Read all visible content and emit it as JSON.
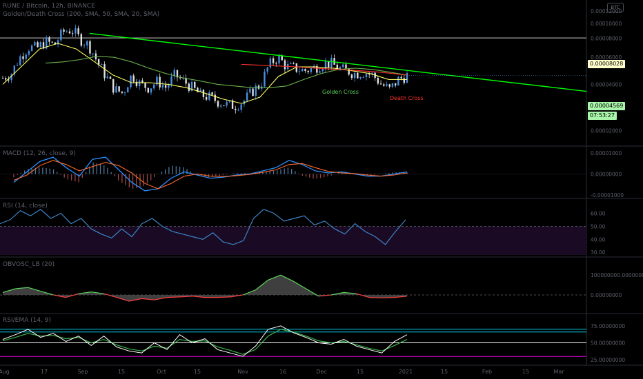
{
  "header": {
    "symbol_line": "RUNE / Bitcoin, 12h, BINANCE",
    "indicator_line": "Golden/Death Cross (200, SMA, 50, SMA, 20, SMA)",
    "currency_badge": "BTC"
  },
  "price_tags": {
    "trendline_level": "0.00008028",
    "last_price": "0.00004569",
    "bar_timer": "07:53:27"
  },
  "annotations": {
    "golden_cross": "Golden Cross",
    "death_cross": "Death Cross"
  },
  "pane_titles": {
    "macd": "MACD (12, 26, close, 9)",
    "rsi": "RSI (14, close)",
    "obv": "OBVOSC_LB (20)",
    "rsi_ema": "RSI/EMA (14, 9)"
  },
  "time_axis": {
    "labels": [
      "Aug",
      "17",
      "Sep",
      "15",
      "Oct",
      "15",
      "Nov",
      "16",
      "Dec",
      "15",
      "2021",
      "15",
      "Feb",
      "15",
      "Mar"
    ]
  },
  "colors": {
    "background": "#000000",
    "up_candle": "#4a8fe0",
    "down_candle": "#e0e0e0",
    "ma_short": "#ffff66",
    "ma_mid": "#6ab04c",
    "ma_long": "#ff3030",
    "trendline": "#00ff00",
    "macd": "#2b8fff",
    "signal": "#ff6b2b",
    "rsi": "#3d85c6",
    "rsi_band": "#1a0a24",
    "obv_pos": "#5cd65c",
    "obv_neg": "#ff4040",
    "rsi_ema_fast": "#ffffff",
    "rsi_ema_slow": "#39b54a",
    "level_cyan": "#00e5ff",
    "level_magenta": "#ff00ff"
  },
  "chart_data": [
    {
      "type": "candlestick",
      "title": "RUNE / Bitcoin, 12h, BINANCE",
      "x_axis": "time",
      "y_scale": "log",
      "y_ticks": [
        "0.00012000",
        "0.00010000",
        "0.00008000",
        "0.00006000",
        "0.00004000",
        "0.00002000"
      ],
      "approx_closes_btc": [
        4.4e-05,
        4.7e-05,
        6e-05,
        7e-05,
        6.9e-05,
        7.6e-05,
        7.2e-05,
        8.8e-05,
        9.1e-05,
        7.9e-05,
        7.2e-05,
        5.6e-05,
        4.5e-05,
        3.7e-05,
        3.5e-05,
        4.6e-05,
        4e-05,
        3.8e-05,
        4.2e-05,
        3.8e-05,
        4.6e-05,
        4.2e-05,
        3.8e-05,
        3.4e-05,
        3.3e-05,
        3.1e-05,
        2.95e-05,
        2.9e-05,
        3.1e-05,
        3.6e-05,
        4e-05,
        5.4e-05,
        6e-05,
        5.2e-05,
        5.1e-05,
        4.9e-05,
        5.05e-05,
        5.4e-05,
        5.55e-05,
        5.1e-05,
        4.9e-05,
        4.7e-05,
        4.8e-05,
        4.6e-05,
        4e-05,
        3.7e-05,
        4.3e-05,
        4.57e-05
      ],
      "overlays": [
        {
          "name": "SMA 20",
          "approx_values": [
            4e-05,
            5.2e-05,
            6.8e-05,
            7.4e-05,
            6.8e-05,
            5.6e-05,
            4.6e-05,
            4.1e-05,
            4.1e-05,
            4e-05,
            3.8e-05,
            3.5e-05,
            3.2e-05,
            3e-05,
            3.3e-05,
            4.5e-05,
            5.2e-05,
            5.2e-05,
            5.1e-05,
            4.9e-05,
            4.7e-05,
            4.3e-05,
            4.3e-05
          ]
        },
        {
          "name": "SMA 50",
          "approx_values": [
            5.5e-05,
            5.6e-05,
            5.8e-05,
            6.1e-05,
            6e-05,
            5.6e-05,
            5.1e-05,
            4.7e-05,
            4.4e-05,
            4.2e-05,
            4e-05,
            3.9e-05,
            3.8e-05,
            3.8e-05,
            3.9e-05,
            4.3e-05,
            4.7e-05,
            5e-05,
            5.1e-05,
            5e-05,
            4.8e-05,
            4.6e-05
          ]
        },
        {
          "name": "SMA 200",
          "approx_values": [
            5.4e-05,
            5.3e-05,
            5.2e-05,
            5.05e-05,
            4.95e-05,
            4.8e-05,
            4.6e-05
          ]
        },
        {
          "name": "Trendline",
          "approx_values": [
            8.6e-05,
            3.6e-05
          ]
        }
      ]
    },
    {
      "type": "line",
      "title": "MACD (12, 26, close, 9)",
      "y_ticks": [
        "0.00001000",
        "0.00000000",
        "-0.00001000"
      ],
      "series": [
        {
          "name": "MACD",
          "approx_values": [
            -0.4,
            0.1,
            0.6,
            0.8,
            0.3,
            -0.1,
            0.7,
            0.8,
            0.2,
            -0.4,
            -0.8,
            -0.7,
            -0.2,
            0.1,
            -0.05,
            -0.2,
            -0.15,
            -0.05,
            0.0,
            0.15,
            0.3,
            0.65,
            0.45,
            0.15,
            0.05,
            0.1,
            0.0,
            -0.1,
            -0.1,
            0.0,
            0.1
          ]
        },
        {
          "name": "Signal",
          "approx_values": [
            -0.3,
            -0.05,
            0.4,
            0.65,
            0.45,
            0.15,
            0.35,
            0.55,
            0.4,
            0.05,
            -0.45,
            -0.7,
            -0.45,
            -0.1,
            0.0,
            -0.1,
            -0.12,
            -0.08,
            -0.02,
            0.08,
            0.2,
            0.45,
            0.5,
            0.3,
            0.12,
            0.05,
            0.02,
            -0.05,
            -0.1,
            -0.05,
            0.05
          ]
        }
      ]
    },
    {
      "type": "line",
      "title": "RSI (14, close)",
      "y_ticks": [
        "60.00",
        "50.00",
        "40.00",
        "30.00"
      ],
      "series": [
        {
          "name": "RSI",
          "approx_values": [
            52,
            55,
            62,
            58,
            63,
            56,
            60,
            52,
            56,
            48,
            44,
            41,
            48,
            42,
            52,
            56,
            50,
            46,
            44,
            42,
            40,
            45,
            38,
            36,
            39,
            56,
            63,
            60,
            54,
            56,
            58,
            51,
            54,
            48,
            44,
            52,
            46,
            42,
            36,
            46,
            55
          ]
        }
      ]
    },
    {
      "type": "area",
      "title": "OBVOSC_LB (20)",
      "y_ticks": [
        "100000000.00000000",
        "0.00000000"
      ],
      "series": [
        {
          "name": "OBV Oscillator",
          "approx_values": [
            0.1,
            0.25,
            0.3,
            0.15,
            0.0,
            -0.1,
            0.05,
            0.12,
            0.05,
            -0.1,
            -0.25,
            -0.15,
            -0.2,
            -0.1,
            -0.08,
            -0.05,
            -0.1,
            -0.1,
            -0.08,
            0.0,
            0.2,
            0.6,
            0.8,
            0.55,
            0.25,
            -0.05,
            0.0,
            0.1,
            0.05,
            -0.1,
            -0.12,
            -0.1,
            -0.05
          ]
        }
      ]
    },
    {
      "type": "line",
      "title": "RSI/EMA (14, 9)",
      "y_ticks": [
        "75.00000000",
        "50.00000000",
        "25.00000000"
      ],
      "levels": [
        70,
        66,
        50,
        30
      ],
      "series": [
        {
          "name": "RSI",
          "approx_values": [
            55,
            62,
            70,
            58,
            64,
            52,
            60,
            46,
            60,
            44,
            38,
            35,
            50,
            40,
            62,
            50,
            56,
            40,
            35,
            30,
            45,
            70,
            75,
            65,
            58,
            50,
            48,
            55,
            45,
            40,
            35,
            52,
            62
          ]
        },
        {
          "name": "EMA",
          "approx_values": [
            53,
            58,
            64,
            60,
            61,
            56,
            58,
            50,
            55,
            47,
            41,
            38,
            45,
            42,
            55,
            52,
            53,
            44,
            39,
            33,
            40,
            60,
            70,
            66,
            60,
            53,
            50,
            52,
            47,
            42,
            38,
            46,
            55
          ]
        }
      ]
    }
  ]
}
